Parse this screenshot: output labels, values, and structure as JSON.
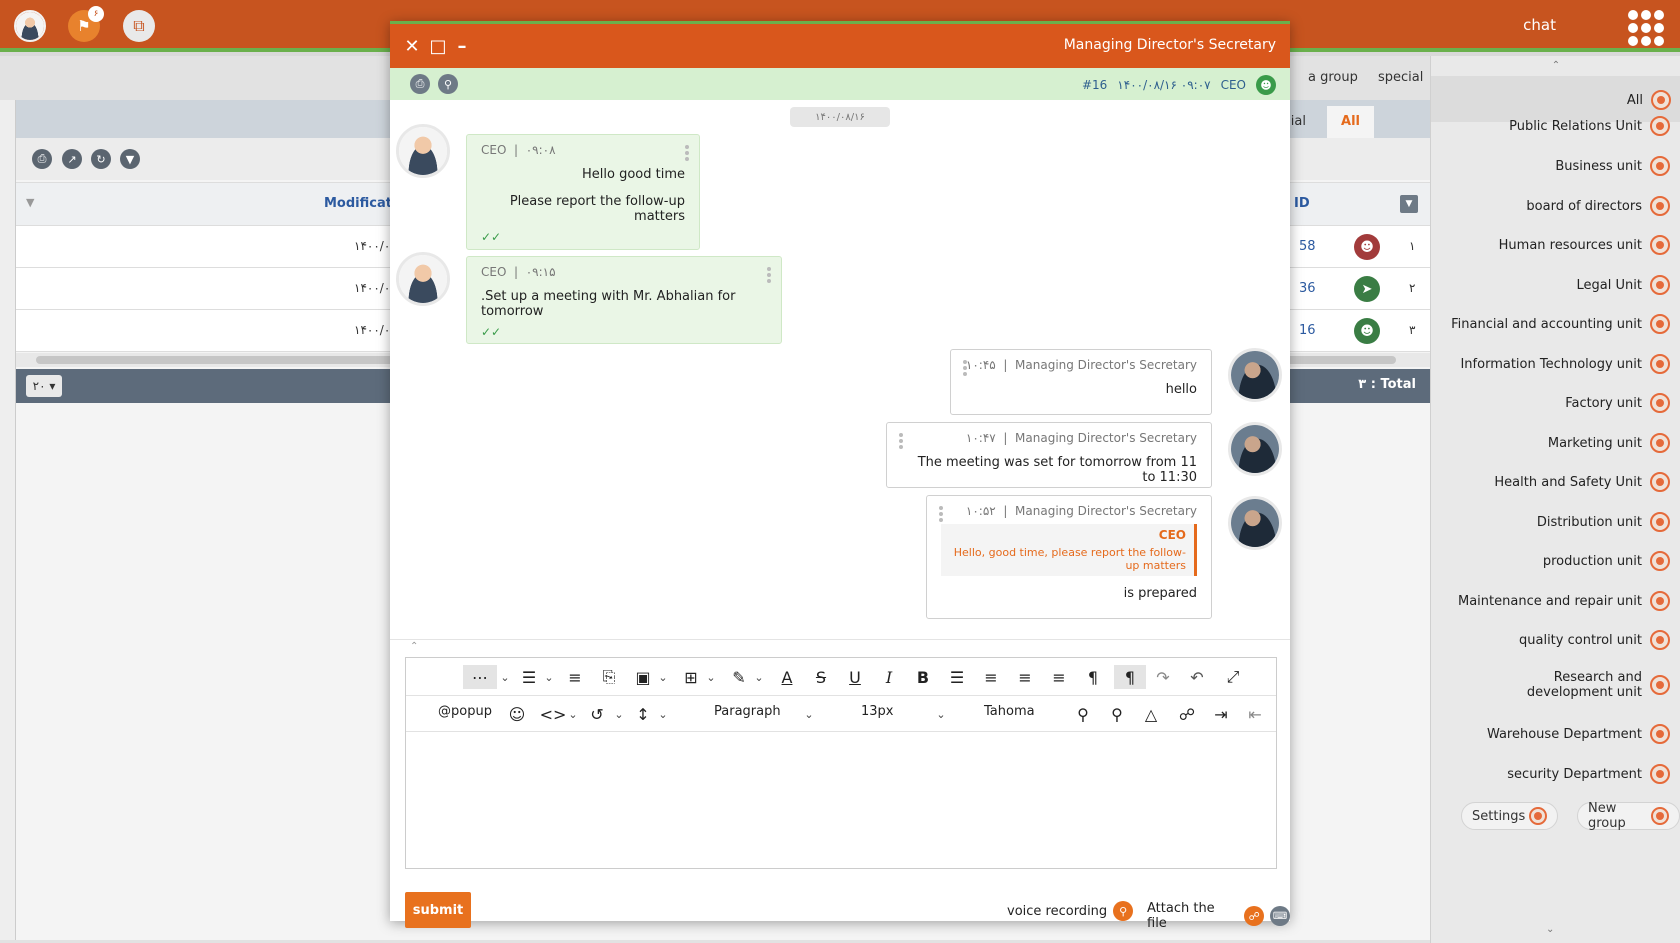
{
  "topbar": {
    "title": "chat",
    "notification_count": "۶",
    "colors": {
      "bar": "#c7541f",
      "accent": "#6ab04c"
    }
  },
  "background_page": {
    "tabs": [
      "special",
      "All"
    ],
    "header": {
      "modification": "Modificatio",
      "id": "ID"
    },
    "rows": [
      {
        "date": "۱۴۰۰/۰",
        "id": "58",
        "index": "۱",
        "icon": "user-icon",
        "color": "#a23b3b"
      },
      {
        "date": "۱۴۰۰/۰",
        "id": "36",
        "index": "۲",
        "icon": "megaphone-icon",
        "color": "#3a7d44"
      },
      {
        "date": "۱۴۰۰/۰",
        "id": "16",
        "index": "۳",
        "icon": "user-icon",
        "color": "#3a7d44"
      }
    ],
    "page_size": "۲۰",
    "total": "۳ : Total"
  },
  "top_tabs": [
    "a group",
    "special"
  ],
  "sidebar": {
    "all_label": "All",
    "items": [
      "Public Relations Unit",
      "Business unit",
      "board of directors",
      "Human resources unit",
      "Legal Unit",
      "Financial and accounting unit",
      "Information Technology unit",
      "Factory unit",
      "Marketing unit",
      "Health and Safety Unit",
      "Distribution unit",
      "production unit",
      "Maintenance and repair unit",
      "quality control unit",
      "Research and development unit",
      "Warehouse Department",
      "security Department"
    ],
    "settings_label": "Settings",
    "new_group_label": "New group"
  },
  "chat": {
    "title": "Managing Director's Secretary",
    "sub": {
      "sender": "CEO",
      "datetime": "۱۴۰۰/۰۸/۱۶ ۰۹:۰۷",
      "ref": "#16"
    },
    "date_chip": "۱۴۰۰/۰۸/۱۶",
    "messages": [
      {
        "author": "CEO",
        "time": "۰۹:۰۸",
        "lines": [
          "Hello good time",
          "Please report the follow-up matters"
        ]
      },
      {
        "author": "CEO",
        "time": "۰۹:۱۵",
        "lines": [
          ".Set up a meeting with Mr. Abhalian for tomorrow"
        ]
      },
      {
        "author": "Managing Director's Secretary",
        "time": "۱۰:۴۵",
        "lines": [
          "hello"
        ]
      },
      {
        "author": "Managing Director's Secretary",
        "time": "۱۰:۴۷",
        "lines": [
          "The meeting was set for tomorrow from 11 to 11:30"
        ]
      },
      {
        "author": "Managing Director's Secretary",
        "time": "۱۰:۵۲",
        "quote_author": "CEO",
        "quote_text": "Hello, good time, please report the follow-up matters",
        "lines": [
          "is prepared"
        ]
      }
    ],
    "editor": {
      "popup": "@popup",
      "block_format": "Paragraph",
      "font_size": "13px",
      "font_family": "Tahoma"
    },
    "footer": {
      "submit": "submit",
      "voice": "voice recording",
      "attach": "Attach the file"
    }
  }
}
